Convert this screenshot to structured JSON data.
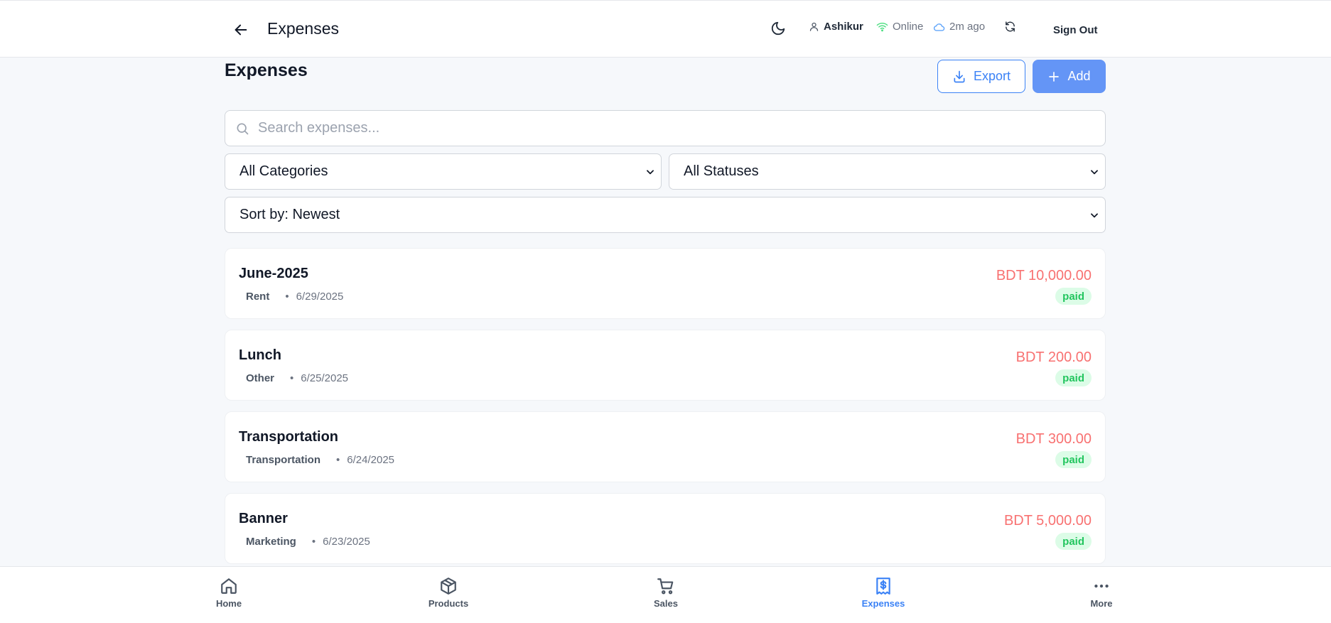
{
  "header": {
    "title": "Expenses",
    "user": "Ashikur",
    "connection": "Online",
    "last_sync": "2m ago",
    "sign_out": "Sign Out"
  },
  "main": {
    "title": "Expenses",
    "export_label": "Export",
    "add_label": "Add",
    "search_placeholder": "Search expenses...",
    "category_filter": "All Categories",
    "status_filter": "All Statuses",
    "sort": "Sort by: Newest"
  },
  "expenses": [
    {
      "name": "June-2025",
      "category": "Rent",
      "date": "6/29/2025",
      "amount": "BDT 10,000.00",
      "status": "paid"
    },
    {
      "name": "Lunch",
      "category": "Other",
      "date": "6/25/2025",
      "amount": "BDT 200.00",
      "status": "paid"
    },
    {
      "name": "Transportation",
      "category": "Transportation",
      "date": "6/24/2025",
      "amount": "BDT 300.00",
      "status": "paid"
    },
    {
      "name": "Banner",
      "category": "Marketing",
      "date": "6/23/2025",
      "amount": "BDT 5,000.00",
      "status": "paid"
    }
  ],
  "nav": [
    {
      "label": "Home",
      "icon": "home-icon"
    },
    {
      "label": "Products",
      "icon": "package-icon"
    },
    {
      "label": "Sales",
      "icon": "cart-icon"
    },
    {
      "label": "Expenses",
      "icon": "receipt-dollar-icon",
      "active": true
    },
    {
      "label": "More",
      "icon": "more-dots-icon"
    }
  ],
  "colors": {
    "accent": "#3b82f6",
    "amount": "#f87171",
    "paid_bg": "#dcfce7",
    "paid_text": "#22c55e",
    "online": "#4ade80",
    "sync": "#60a5fa"
  }
}
